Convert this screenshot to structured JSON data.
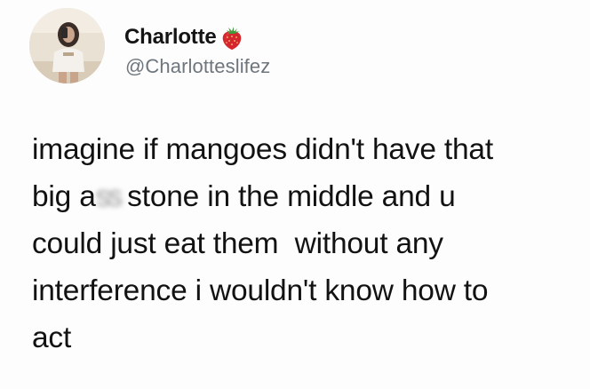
{
  "profile": {
    "display_name": "Charlotte",
    "name_emoji": "strawberry-icon",
    "handle": "@Charlotteslifez"
  },
  "tweet": {
    "lines": [
      {
        "text": "imagine if mangoes didn't have that"
      },
      {
        "pre": "big a",
        "censored": "ss",
        "post": "stone in the middle and u"
      },
      {
        "text": "could just eat them  without any"
      },
      {
        "text": "interference i wouldn't know how to"
      },
      {
        "text": "act"
      }
    ]
  },
  "colors": {
    "name": "#141414",
    "handle": "#6e767d",
    "body": "#121212",
    "strawberry": "#d5262d"
  }
}
